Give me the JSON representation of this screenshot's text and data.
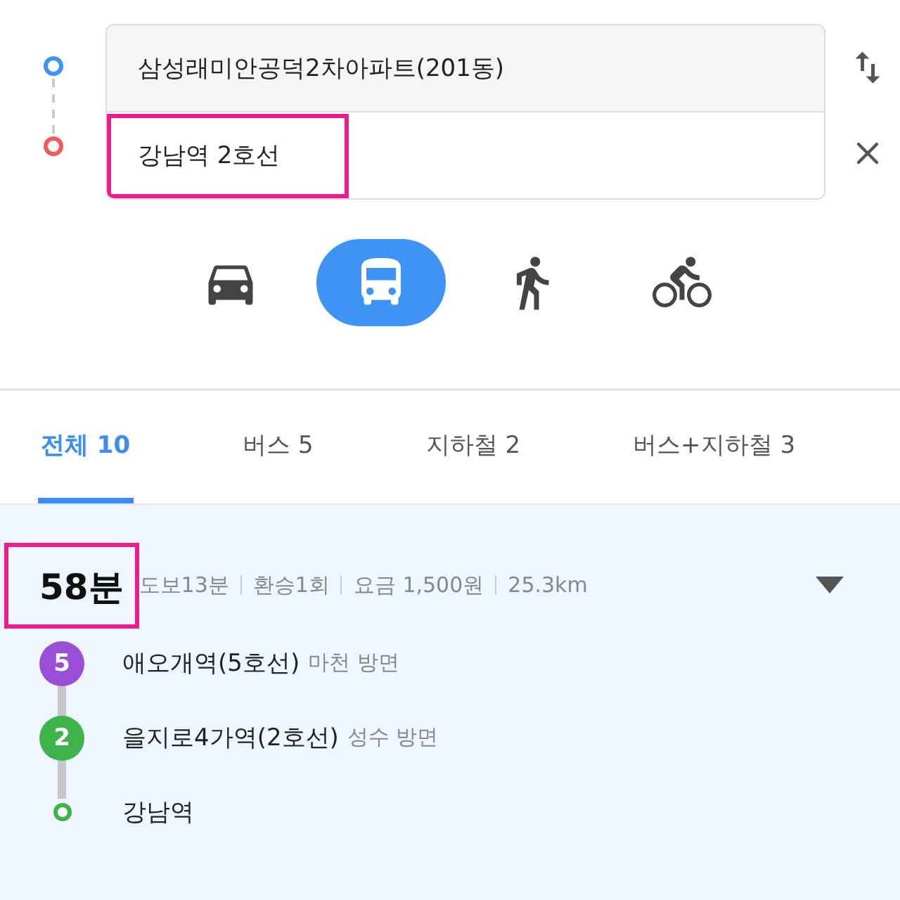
{
  "route_inputs": {
    "origin": {
      "value": "삼성래미안공덕2차아파트(201동)"
    },
    "destination": {
      "value": "강남역 2호선",
      "highlighted": true
    }
  },
  "modes": [
    {
      "kind": "car",
      "selected": false
    },
    {
      "kind": "bus",
      "selected": true
    },
    {
      "kind": "walk",
      "selected": false
    },
    {
      "kind": "bike",
      "selected": false
    }
  ],
  "tabs": [
    {
      "label": "전체 10",
      "selected": true
    },
    {
      "label": "버스 5",
      "selected": false
    },
    {
      "label": "지하철 2",
      "selected": false
    },
    {
      "label": "버스+지하철 3",
      "selected": false
    }
  ],
  "route": {
    "duration": "58분",
    "duration_highlighted": true,
    "details": [
      "도보13분",
      "환승1회",
      "요금 1,500원",
      "25.3km"
    ],
    "steps": [
      {
        "kind": "line",
        "badge": "5",
        "color": "#9a4fd6",
        "station": "애오개역(5호선)",
        "direction": "마천 방면"
      },
      {
        "kind": "line",
        "badge": "2",
        "color": "#3db34a",
        "station": "을지로4가역(2호선)",
        "direction": "성수 방면"
      },
      {
        "kind": "end",
        "color": "#3db34a",
        "station": "강남역"
      }
    ]
  }
}
